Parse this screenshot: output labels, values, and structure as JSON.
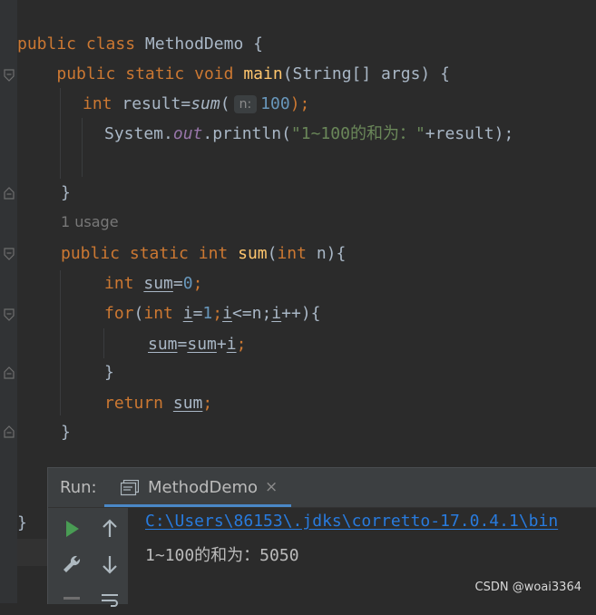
{
  "editor": {
    "tokens": {
      "public": "public",
      "class": "class",
      "class_name": "MethodDemo",
      "open_brace": " {",
      "static": "static",
      "void": "void",
      "main": "main",
      "main_params": "(String[] args) {",
      "int": "int",
      "result_assign": " result=",
      "sum_call": "sum",
      "open_paren": "(",
      "hint_n": "n:",
      "num_100": "100",
      "close_stmt": ");",
      "system": "System.",
      "out": "out",
      "println_open": ".println(",
      "string_literal": "\"1~100的和为：\"",
      "println_tail": "+result);",
      "close_brace": "}",
      "sum_method": "sum",
      "sum_params_open": "(",
      "sum_params_tail": " n){",
      "var_sum": "sum",
      "eq": "=",
      "num_0": "0",
      "semi": ";",
      "for": "for",
      "var_i": "i",
      "num_1": "1",
      "lt_n": "<=n;",
      "inc_tail": "++){",
      "plus": "+",
      "return": "return",
      "space": " "
    },
    "usage_hint": "1 usage"
  },
  "run_panel": {
    "label": "Run:",
    "tab_label": "MethodDemo",
    "close_glyph": "×",
    "output": {
      "command_line": "C:\\Users\\86153\\.jdks\\corretto-17.0.4.1\\bin",
      "result_line": "1~100的和为：5050"
    }
  },
  "icons": {
    "fold": "fold-icon",
    "run": "run-icon",
    "rerun_up": "arrow-up-icon",
    "wrench": "wrench-icon",
    "arrow_down": "arrow-down-icon",
    "console": "console-icon",
    "soft_wrap": "soft-wrap-icon"
  },
  "colors": {
    "background": "#2b2b2b",
    "keyword": "#cc7832",
    "function": "#ffc66d",
    "number": "#6897bb",
    "string": "#6a8759",
    "static_field": "#9876aa",
    "link": "#287bde",
    "run_green": "#499c54",
    "tab_underline": "#4a88c7"
  },
  "watermark": "CSDN @woai3364"
}
